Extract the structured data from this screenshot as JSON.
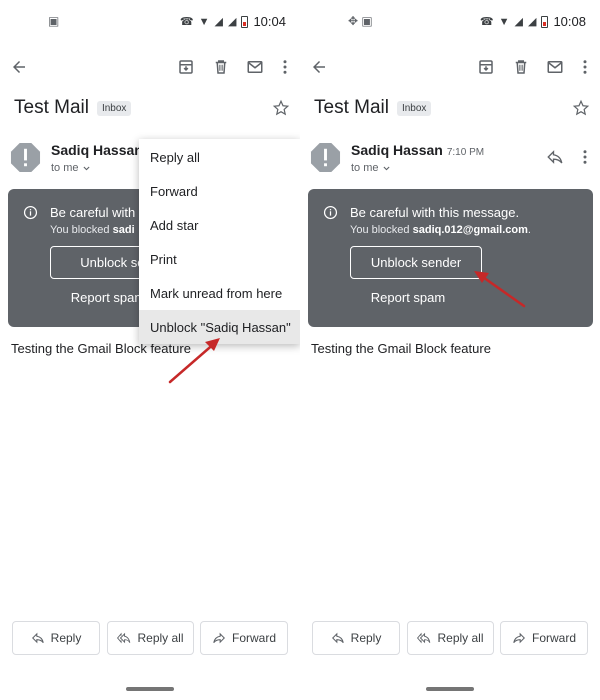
{
  "left": {
    "status": {
      "time": "10:04"
    },
    "email": {
      "subject": "Test Mail",
      "label": "Inbox",
      "sender_name": "Sadiq Hassan",
      "recipient": "to me",
      "warning_title": "Be careful with",
      "warning_body_prefix": "You blocked",
      "warning_email": "sadi",
      "unblock_label": "Unblock sen",
      "report_spam_label": "Report spam",
      "body": "Testing the Gmail Block feature"
    },
    "menu": {
      "items": [
        {
          "label": "Reply all"
        },
        {
          "label": "Forward"
        },
        {
          "label": "Add star"
        },
        {
          "label": "Print"
        },
        {
          "label": "Mark unread from here"
        },
        {
          "label": "Unblock \"Sadiq Hassan\""
        }
      ]
    },
    "actions": {
      "reply": "Reply",
      "reply_all": "Reply all",
      "forward": "Forward"
    }
  },
  "right": {
    "status": {
      "time": "10:08"
    },
    "email": {
      "subject": "Test Mail",
      "label": "Inbox",
      "sender_name": "Sadiq Hassan",
      "sender_time": "7:10 PM",
      "recipient": "to me",
      "warning_title": "Be careful with this message.",
      "warning_body_prefix": "You blocked",
      "warning_email": "sadiq.012@gmail.com",
      "warning_body_suffix": ".",
      "unblock_label": "Unblock sender",
      "report_spam_label": "Report spam",
      "body": "Testing the Gmail Block feature"
    },
    "actions": {
      "reply": "Reply",
      "reply_all": "Reply all",
      "forward": "Forward"
    }
  },
  "colors": {
    "warning_card": "#5f6368",
    "annotation_arrow": "#c62828",
    "menu_highlight": "#e8e8e8",
    "battery": "#d93025"
  },
  "icons": {
    "toolbar": [
      "back-arrow-icon",
      "archive-icon",
      "delete-icon",
      "mail-icon",
      "more-vert-icon"
    ],
    "sender": [
      "avatar-alert-icon",
      "reply-icon",
      "more-vert-icon"
    ],
    "card": [
      "info-icon"
    ]
  }
}
